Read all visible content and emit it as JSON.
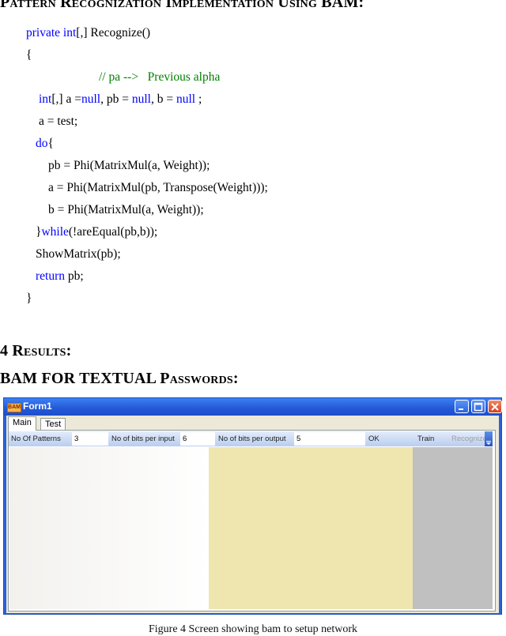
{
  "headings": {
    "pattern": "Pattern Recognization Implementation Using BAM:",
    "results": "4 Results:",
    "bam": "BAM FOR TEXTUAL Passwords:"
  },
  "code": [
    [
      {
        "t": "private int",
        "c": "kw"
      },
      {
        "t": "[,] Recognize()",
        "c": ""
      }
    ],
    [
      {
        "t": "{",
        "c": ""
      }
    ],
    [
      {
        "t": "// pa -->   Previous alpha",
        "c": "cm"
      }
    ],
    [
      {
        "t": "int",
        "c": "kw"
      },
      {
        "t": "[,] a =",
        "c": ""
      },
      {
        "t": "null",
        "c": "kw"
      },
      {
        "t": ", pb = ",
        "c": ""
      },
      {
        "t": "null",
        "c": "kw"
      },
      {
        "t": ", b = ",
        "c": ""
      },
      {
        "t": "null",
        "c": "kw"
      },
      {
        "t": " ;",
        "c": ""
      }
    ],
    [
      {
        "t": "a = test;",
        "c": ""
      }
    ],
    [
      {
        "t": "do",
        "c": "kw"
      },
      {
        "t": "{",
        "c": ""
      }
    ],
    [
      {
        "t": "pb = Phi(MatrixMul(a, Weight));",
        "c": ""
      }
    ],
    [
      {
        "t": "a = Phi(MatrixMul(pb, Transpose(Weight)));",
        "c": ""
      }
    ],
    [
      {
        "t": "b = Phi(MatrixMul(a, Weight));",
        "c": ""
      }
    ],
    [
      {
        "t": "}",
        "c": ""
      },
      {
        "t": "while",
        "c": "kw"
      },
      {
        "t": "(!areEqual(pb,b));",
        "c": ""
      }
    ],
    [
      {
        "t": "ShowMatrix(pb);",
        "c": ""
      }
    ],
    [
      {
        "t": "return",
        "c": "kw"
      },
      {
        "t": " pb;",
        "c": ""
      }
    ],
    [
      {
        "t": "}",
        "c": ""
      }
    ]
  ],
  "window": {
    "title": "Form1",
    "icon_text": "BAM",
    "tabs": [
      "Main",
      "Test"
    ],
    "toolbar": {
      "patterns_label": "No Of Patterns",
      "patterns_value": "3",
      "bits_in_label": "No of bits per input",
      "bits_in_value": "6",
      "bits_out_label": "No of bits per output",
      "bits_out_value": "5",
      "ok_label": "OK",
      "train_label": "Train",
      "recognize_label": "Recognize"
    }
  },
  "caption": "Figure 4 Screen showing bam to setup network",
  "colors": {
    "keyword": "#0000ff",
    "comment": "#008000",
    "panel_mid": "#eee6ae",
    "panel_right": "#c0c0c0"
  }
}
